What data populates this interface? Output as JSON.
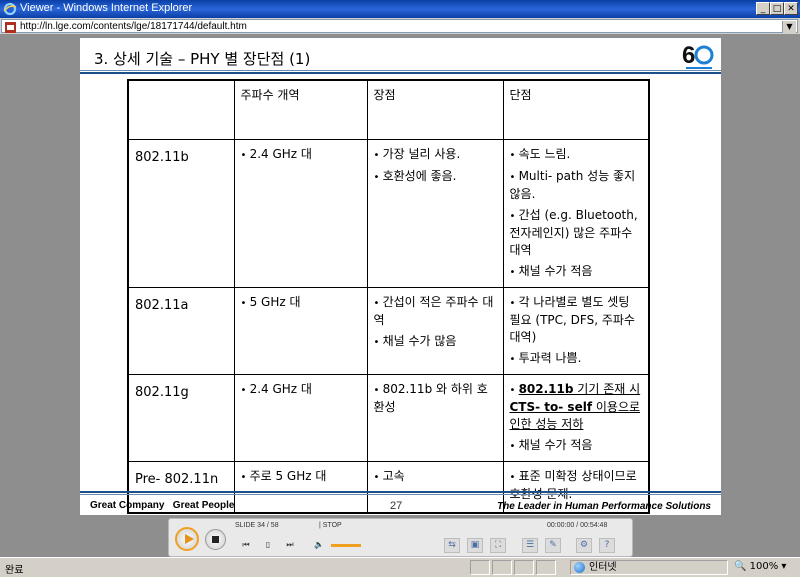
{
  "window": {
    "title": "Viewer - Windows Internet Explorer",
    "url": "http://ln.lge.com/contents/lge/18171744/default.htm"
  },
  "slide": {
    "title": "3. 상세 기술 – PHY 별 장단점 (1)",
    "headers": [
      "",
      "주파수 개역",
      "장점",
      "단점"
    ],
    "rows": [
      {
        "name": "802.11b",
        "freq": [
          "2.4 GHz 대"
        ],
        "pros": [
          "가장 널리 사용.",
          "호환성에 좋음."
        ],
        "cons": [
          "속도 느림.",
          "Multi- path 성능 좋지 않음.",
          "간섭 (e.g. Bluetooth, 전자레인지) 많은 주파수 대역",
          "채널 수가 적음"
        ]
      },
      {
        "name": "802.11a",
        "freq": [
          "5 GHz 대"
        ],
        "pros": [
          "간섭이 적은 주파수 대역",
          "채널 수가 많음"
        ],
        "cons": [
          "각 나라별로 별도 셋팅 필요 (TPC, DFS, 주파수 대역)",
          "투과력 나쁨."
        ]
      },
      {
        "name": "802.11g",
        "freq": [
          "2.4 GHz 대"
        ],
        "pros": [
          "802.11b 와 하위 호환성"
        ],
        "cons_bold": {
          "a": "802.11b",
          "b": " 기기 존재 시 ",
          "c": "CTS- to- self",
          "d": " 이용으로 인한 성능 저하"
        },
        "cons": [
          "채널 수가 적음"
        ]
      },
      {
        "name": "Pre- 802.11n",
        "freq": [
          "주로 5 GHz 대"
        ],
        "pros": [
          "고속"
        ],
        "cons": [
          "표준 미확정 상태이므로 호환성 문제."
        ]
      }
    ],
    "footer": {
      "left": "Great Company   Great People",
      "page": "27",
      "right": "The Leader in Human Performance Solutions"
    },
    "logo": "60"
  },
  "player": {
    "slide_info": "SLIDE  34 /  58",
    "state": "|  STOP",
    "time": "00:00:00 / 00:54:48"
  },
  "status": {
    "text": "완료",
    "zone": "인터넷",
    "zoom": "100%"
  },
  "colors": {
    "accent": "#1d4f8a",
    "play": "#f0a020"
  }
}
